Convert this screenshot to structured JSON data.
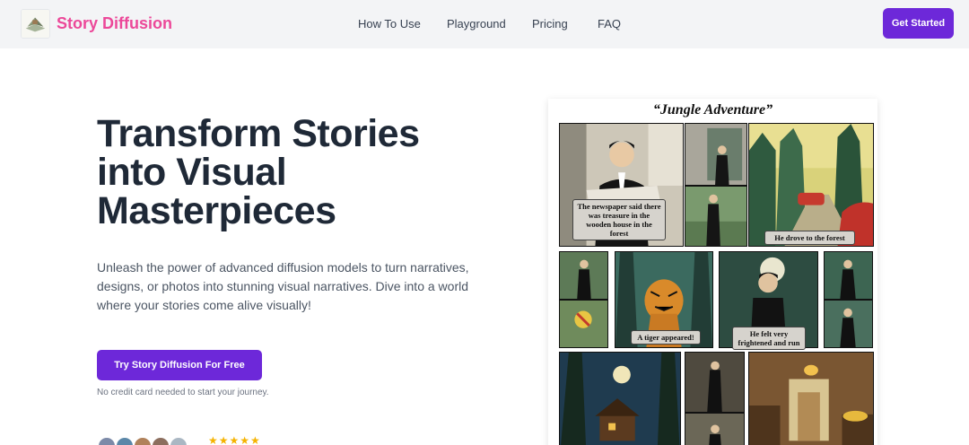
{
  "header": {
    "brand": "Story Diffusion",
    "nav": [
      "How To Use",
      "Playground",
      "Pricing",
      "FAQ"
    ],
    "cta": "Get Started",
    "colors": {
      "brand": "#ec4899",
      "accent": "#6d28d9",
      "bar": "#f3f4f6"
    }
  },
  "hero": {
    "title": "Transform Stories into Visual Masterpieces",
    "description": "Unleash the power of advanced diffusion models to turn narratives, designs, or photos into stunning visual narratives. Dive into a world where your stories come alive visually!",
    "cta": "Try Story Diffusion For Free",
    "note": "No credit card needed to start your journey.",
    "rating_stars": "★★★★★"
  },
  "comic": {
    "title": "“Jungle Adventure”",
    "captions": {
      "newspaper": "The newspaper said there was treasure in the wooden house in the forest",
      "drive": "He drove to the forest",
      "tiger": "A tiger appeared!",
      "fright": "He felt very frightened and run"
    }
  }
}
